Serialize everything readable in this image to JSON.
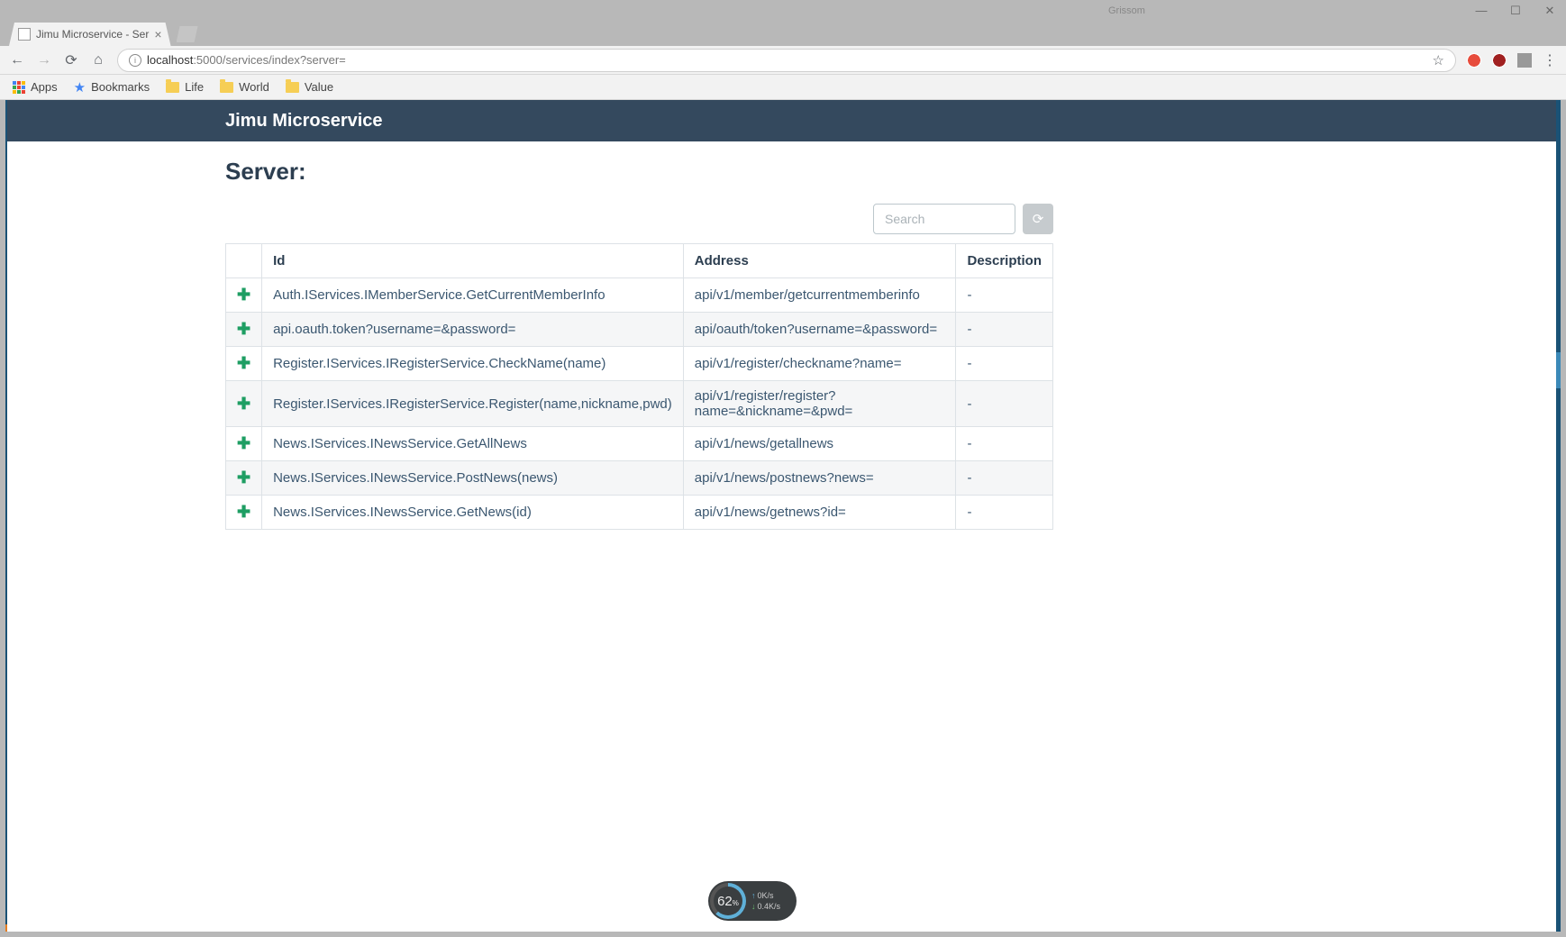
{
  "window": {
    "user_label": "Grissom",
    "minimize": "—",
    "maximize": "☐",
    "close": "✕"
  },
  "browser": {
    "tab_title": "Jimu Microservice - Ser",
    "url_host": "localhost",
    "url_path": ":5000/services/index?server=",
    "bookmarks": {
      "apps": "Apps",
      "bookmarks": "Bookmarks",
      "life": "Life",
      "world": "World",
      "value": "Value"
    }
  },
  "app": {
    "title": "Jimu Microservice",
    "heading": "Server:",
    "search_placeholder": "Search",
    "columns": {
      "id": "Id",
      "address": "Address",
      "description": "Description"
    },
    "rows": [
      {
        "id": "Auth.IServices.IMemberService.GetCurrentMemberInfo",
        "address": "api/v1/member/getcurrentmemberinfo",
        "desc": "-"
      },
      {
        "id": "api.oauth.token?username=&password=",
        "address": "api/oauth/token?username=&password=",
        "desc": "-"
      },
      {
        "id": "Register.IServices.IRegisterService.CheckName(name)",
        "address": "api/v1/register/checkname?name=",
        "desc": "-"
      },
      {
        "id": "Register.IServices.IRegisterService.Register(name,nickname,pwd)",
        "address": "api/v1/register/register?name=&nickname=&pwd=",
        "desc": "-"
      },
      {
        "id": "News.IServices.INewsService.GetAllNews",
        "address": "api/v1/news/getallnews",
        "desc": "-"
      },
      {
        "id": "News.IServices.INewsService.PostNews(news)",
        "address": "api/v1/news/postnews?news=",
        "desc": "-"
      },
      {
        "id": "News.IServices.INewsService.GetNews(id)",
        "address": "api/v1/news/getnews?id=",
        "desc": "-"
      }
    ]
  },
  "overlay": {
    "percent": "62",
    "percent_suffix": "%",
    "net_up": "0K/s",
    "net_dn": "0.4K/s"
  }
}
